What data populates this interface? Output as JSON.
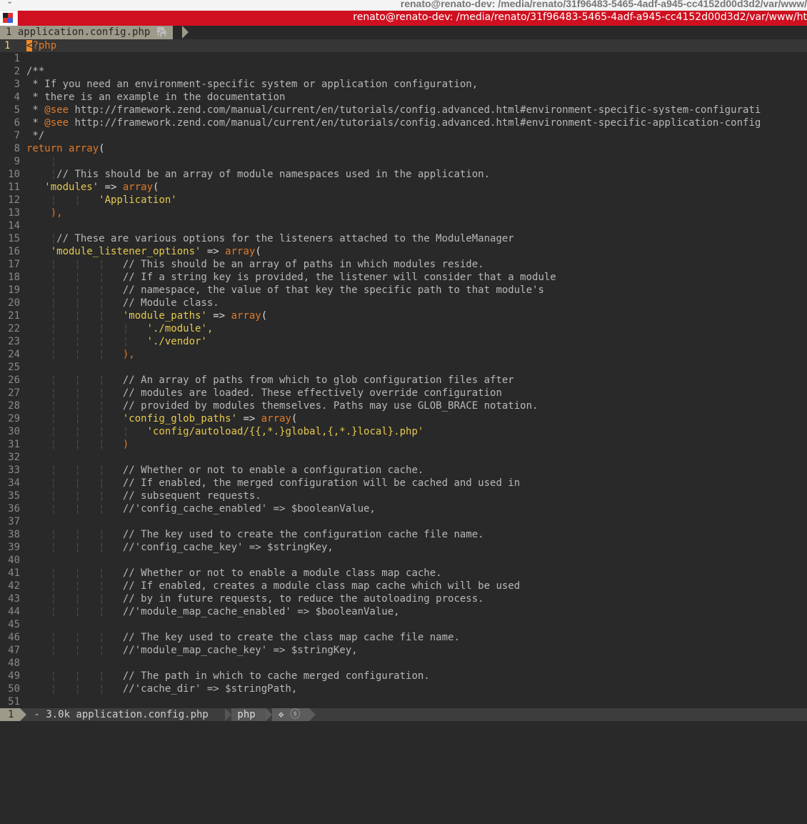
{
  "os": {
    "window_title": "renato@renato-dev: /media/renato/31f96483-5465-4adf-a945-cc4152d00d3d2/var/www/"
  },
  "terminal": {
    "title": "renato@renato-dev: /media/renato/31f96483-5465-4adf-a945-cc4152d00d3d2/var/www/ht",
    "icon": "terminal-app-icon"
  },
  "tabline": {
    "tab_number": "1",
    "tab_label": "application.config.php",
    "tab_icon": "elephant-icon"
  },
  "editor": {
    "lines": [
      {
        "n": "1",
        "segs": [
          [
            "cursor",
            "<"
          ],
          [
            "kw",
            "?php"
          ]
        ]
      },
      {
        "n": "1",
        "segs": []
      },
      {
        "n": "2",
        "segs": [
          [
            "com",
            "/**"
          ]
        ]
      },
      {
        "n": "3",
        "segs": [
          [
            "com",
            " * If you need an environment-specific system or application configuration,"
          ]
        ]
      },
      {
        "n": "4",
        "segs": [
          [
            "com",
            " * there is an example in the documentation"
          ]
        ]
      },
      {
        "n": "5",
        "segs": [
          [
            "com",
            " * "
          ],
          [
            "kw",
            "@see"
          ],
          [
            "com",
            " http://framework.zend.com/manual/current/en/tutorials/config.advanced.html#environment-specific-system-configurati"
          ]
        ]
      },
      {
        "n": "6",
        "segs": [
          [
            "com",
            " * "
          ],
          [
            "kw",
            "@see"
          ],
          [
            "com",
            " http://framework.zend.com/manual/current/en/tutorials/config.advanced.html#environment-specific-application-config"
          ]
        ]
      },
      {
        "n": "7",
        "segs": [
          [
            "com",
            " */"
          ]
        ]
      },
      {
        "n": "8",
        "segs": [
          [
            "kw",
            "return array"
          ],
          [
            "var",
            "("
          ]
        ]
      },
      {
        "n": "9",
        "segs": [
          [
            "guide",
            "    ¦"
          ]
        ]
      },
      {
        "n": "10",
        "segs": [
          [
            "guide",
            "    ¦"
          ],
          [
            "com",
            "// This should be an array of module namespaces used in the application."
          ]
        ]
      },
      {
        "n": "11",
        "segs": [
          [
            "guide",
            "   "
          ],
          [
            "str",
            "'modules'"
          ],
          [
            "var",
            " => "
          ],
          [
            "kw",
            "array"
          ],
          [
            "var",
            "("
          ]
        ]
      },
      {
        "n": "12",
        "segs": [
          [
            "guide",
            "    ¦   ¦   "
          ],
          [
            "str",
            "'Application'"
          ]
        ]
      },
      {
        "n": "13",
        "segs": [
          [
            "guide",
            "    "
          ],
          [
            "kw",
            "),"
          ]
        ]
      },
      {
        "n": "14",
        "segs": []
      },
      {
        "n": "15",
        "segs": [
          [
            "guide",
            "    ¦"
          ],
          [
            "com",
            "// These are various options for the listeners attached to the ModuleManager"
          ]
        ]
      },
      {
        "n": "16",
        "segs": [
          [
            "guide",
            "    "
          ],
          [
            "str",
            "'module_listener_options'"
          ],
          [
            "var",
            " => "
          ],
          [
            "kw",
            "array"
          ],
          [
            "var",
            "("
          ]
        ]
      },
      {
        "n": "17",
        "segs": [
          [
            "guide",
            "    ¦   ¦   ¦   "
          ],
          [
            "com",
            "// This should be an array of paths in which modules reside."
          ]
        ]
      },
      {
        "n": "18",
        "segs": [
          [
            "guide",
            "    ¦   ¦   ¦   "
          ],
          [
            "com",
            "// If a string key is provided, the listener will consider that a module"
          ]
        ]
      },
      {
        "n": "19",
        "segs": [
          [
            "guide",
            "    ¦   ¦   ¦   "
          ],
          [
            "com",
            "// namespace, the value of that key the specific path to that module's"
          ]
        ]
      },
      {
        "n": "20",
        "segs": [
          [
            "guide",
            "    ¦   ¦   ¦   "
          ],
          [
            "com",
            "// Module class."
          ]
        ]
      },
      {
        "n": "21",
        "segs": [
          [
            "guide",
            "    ¦   ¦   ¦   "
          ],
          [
            "str",
            "'module_paths'"
          ],
          [
            "var",
            " => "
          ],
          [
            "kw",
            "array"
          ],
          [
            "var",
            "("
          ]
        ]
      },
      {
        "n": "22",
        "segs": [
          [
            "guide",
            "    ¦   ¦   ¦   ¦   "
          ],
          [
            "str",
            "'./module',"
          ]
        ]
      },
      {
        "n": "23",
        "segs": [
          [
            "guide",
            "    ¦   ¦   ¦   ¦   "
          ],
          [
            "str",
            "'./vendor'"
          ]
        ]
      },
      {
        "n": "24",
        "segs": [
          [
            "guide",
            "    ¦   ¦   ¦   "
          ],
          [
            "kw",
            "),"
          ]
        ]
      },
      {
        "n": "25",
        "segs": []
      },
      {
        "n": "26",
        "segs": [
          [
            "guide",
            "    ¦   ¦   ¦   "
          ],
          [
            "com",
            "// An array of paths from which to glob configuration files after"
          ]
        ]
      },
      {
        "n": "27",
        "segs": [
          [
            "guide",
            "    ¦   ¦   ¦   "
          ],
          [
            "com",
            "// modules are loaded. These effectively override configuration"
          ]
        ]
      },
      {
        "n": "28",
        "segs": [
          [
            "guide",
            "    ¦   ¦   ¦   "
          ],
          [
            "com",
            "// provided by modules themselves. Paths may use GLOB_BRACE notation."
          ]
        ]
      },
      {
        "n": "29",
        "segs": [
          [
            "guide",
            "    ¦   ¦   ¦   "
          ],
          [
            "str",
            "'config_glob_paths'"
          ],
          [
            "var",
            " => "
          ],
          [
            "kw",
            "array"
          ],
          [
            "var",
            "("
          ]
        ]
      },
      {
        "n": "30",
        "segs": [
          [
            "guide",
            "    ¦   ¦   ¦   ¦   "
          ],
          [
            "str",
            "'config/autoload/{{,*.}global,{,*.}local}.php'"
          ]
        ]
      },
      {
        "n": "31",
        "segs": [
          [
            "guide",
            "    ¦   ¦   ¦   "
          ],
          [
            "kw",
            ")"
          ]
        ]
      },
      {
        "n": "32",
        "segs": []
      },
      {
        "n": "33",
        "segs": [
          [
            "guide",
            "    ¦   ¦   ¦   "
          ],
          [
            "com",
            "// Whether or not to enable a configuration cache."
          ]
        ]
      },
      {
        "n": "34",
        "segs": [
          [
            "guide",
            "    ¦   ¦   ¦   "
          ],
          [
            "com",
            "// If enabled, the merged configuration will be cached and used in"
          ]
        ]
      },
      {
        "n": "35",
        "segs": [
          [
            "guide",
            "    ¦   ¦   ¦   "
          ],
          [
            "com",
            "// subsequent requests."
          ]
        ]
      },
      {
        "n": "36",
        "segs": [
          [
            "guide",
            "    ¦   ¦   ¦   "
          ],
          [
            "com",
            "//'config_cache_enabled' => $booleanValue,"
          ]
        ]
      },
      {
        "n": "37",
        "segs": []
      },
      {
        "n": "38",
        "segs": [
          [
            "guide",
            "    ¦   ¦   ¦   "
          ],
          [
            "com",
            "// The key used to create the configuration cache file name."
          ]
        ]
      },
      {
        "n": "39",
        "segs": [
          [
            "guide",
            "    ¦   ¦   ¦   "
          ],
          [
            "com",
            "//'config_cache_key' => $stringKey,"
          ]
        ]
      },
      {
        "n": "40",
        "segs": []
      },
      {
        "n": "41",
        "segs": [
          [
            "guide",
            "    ¦   ¦   ¦   "
          ],
          [
            "com",
            "// Whether or not to enable a module class map cache."
          ]
        ]
      },
      {
        "n": "42",
        "segs": [
          [
            "guide",
            "    ¦   ¦   ¦   "
          ],
          [
            "com",
            "// If enabled, creates a module class map cache which will be used"
          ]
        ]
      },
      {
        "n": "43",
        "segs": [
          [
            "guide",
            "    ¦   ¦   ¦   "
          ],
          [
            "com",
            "// by in future requests, to reduce the autoloading process."
          ]
        ]
      },
      {
        "n": "44",
        "segs": [
          [
            "guide",
            "    ¦   ¦   ¦   "
          ],
          [
            "com",
            "//'module_map_cache_enabled' => $booleanValue,"
          ]
        ]
      },
      {
        "n": "45",
        "segs": []
      },
      {
        "n": "46",
        "segs": [
          [
            "guide",
            "    ¦   ¦   ¦   "
          ],
          [
            "com",
            "// The key used to create the class map cache file name."
          ]
        ]
      },
      {
        "n": "47",
        "segs": [
          [
            "guide",
            "    ¦   ¦   ¦   "
          ],
          [
            "com",
            "//'module_map_cache_key' => $stringKey,"
          ]
        ]
      },
      {
        "n": "48",
        "segs": []
      },
      {
        "n": "49",
        "segs": [
          [
            "guide",
            "    ¦   ¦   ¦   "
          ],
          [
            "com",
            "// The path in which to cache merged configuration."
          ]
        ]
      },
      {
        "n": "50",
        "segs": [
          [
            "guide",
            "    ¦   ¦   ¦   "
          ],
          [
            "com",
            "//'cache_dir' => $stringPath,"
          ]
        ]
      },
      {
        "n": "51",
        "segs": []
      }
    ]
  },
  "statusline": {
    "mode": "1",
    "file_info": " - 3.0k application.config.php ",
    "filetype": " php ",
    "icons": " ❖ ⓢ "
  },
  "colors": {
    "titlebar": "#cf1020",
    "background": "#292929",
    "keyword": "#e07a2a",
    "string": "#e5c94e",
    "comment": "#b8b8b8"
  }
}
